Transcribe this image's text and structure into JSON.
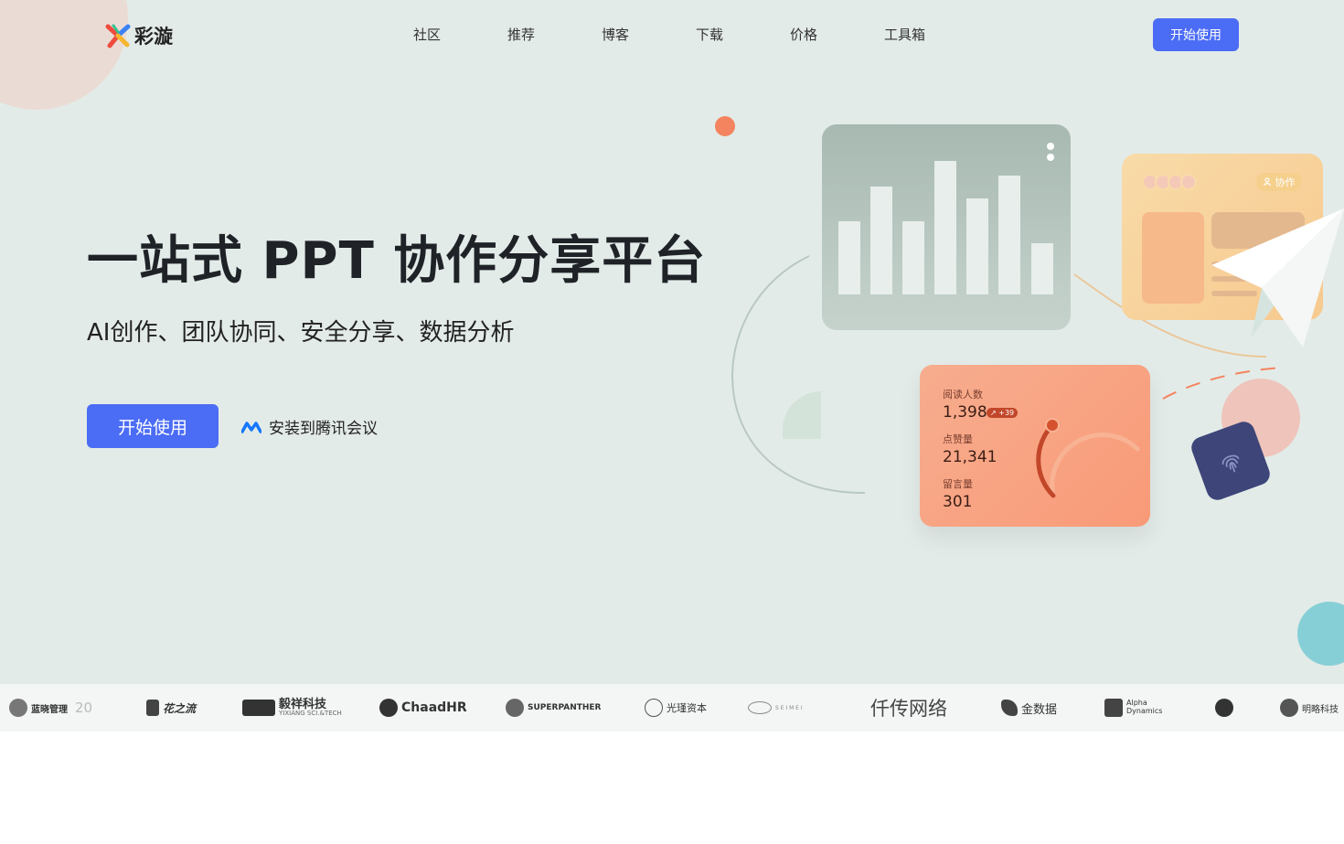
{
  "brand": {
    "name": "彩漩"
  },
  "nav": {
    "items": [
      "社区",
      "推荐",
      "博客",
      "下载",
      "价格",
      "工具箱"
    ],
    "cta": "开始使用"
  },
  "hero": {
    "title": "一站式 PPT 协作分享平台",
    "subtitle": "AI创作、团队协同、安全分享、数据分析",
    "start_button": "开始使用",
    "install_link": "安装到腾讯会议"
  },
  "collab_card": {
    "badge": "协作"
  },
  "stats_card": {
    "readers_label": "阅读人数",
    "readers_value": "1,398",
    "readers_delta": "↗ +39",
    "likes_label": "点赞量",
    "likes_value": "21,341",
    "comments_label": "留言量",
    "comments_value": "301"
  },
  "partners": [
    {
      "name": "蓝晓管理",
      "extra": "20"
    },
    {
      "name": "花之流",
      "extra": ""
    },
    {
      "name": "毅祥科技",
      "extra": "YIXIANG SCI.&TECH"
    },
    {
      "name": "ChaadHR",
      "extra": ""
    },
    {
      "name": "SUPERPANTHER",
      "extra": ""
    },
    {
      "name": "光瑾资本",
      "extra": ""
    },
    {
      "name": "S E I M E I",
      "extra": ""
    },
    {
      "name": "仟传网络",
      "extra": ""
    },
    {
      "name": "金数据",
      "extra": ""
    },
    {
      "name": "Alpha Dynamics",
      "extra": ""
    },
    {
      "name": "",
      "extra": ""
    },
    {
      "name": "明略科技",
      "extra": ""
    }
  ],
  "colors": {
    "accent": "#4b6cf5",
    "hero_bg": "#e3ebe8",
    "stats_card": "#f89a78",
    "gauge_dark": "#c2472a"
  }
}
